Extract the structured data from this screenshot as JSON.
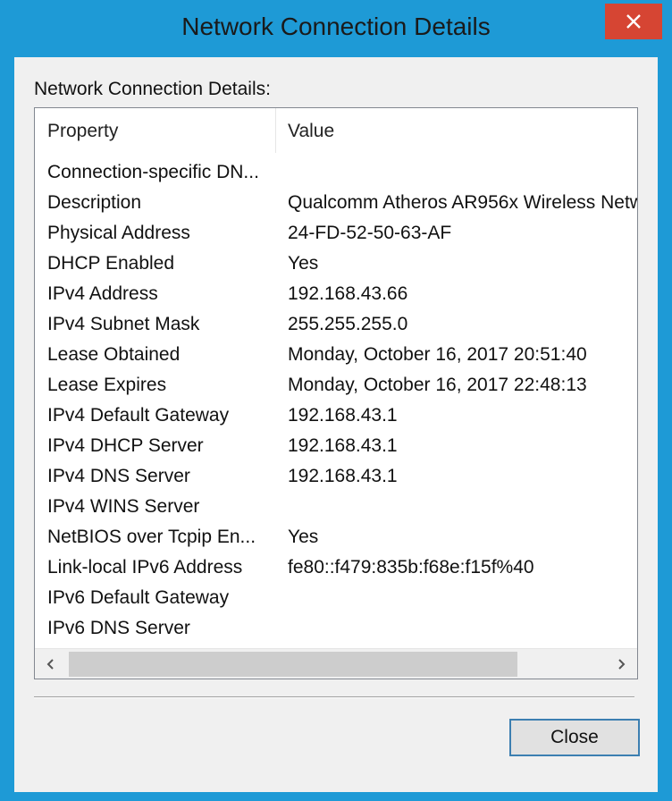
{
  "window": {
    "title": "Network Connection Details",
    "close_icon": "close-icon"
  },
  "group_label": "Network Connection Details:",
  "table": {
    "columns": [
      "Property",
      "Value"
    ],
    "rows": [
      {
        "property": "Connection-specific DN...",
        "value": ""
      },
      {
        "property": "Description",
        "value": "Qualcomm Atheros AR956x Wireless Netw"
      },
      {
        "property": "Physical Address",
        "value": "24-FD-52-50-63-AF"
      },
      {
        "property": "DHCP Enabled",
        "value": "Yes"
      },
      {
        "property": "IPv4 Address",
        "value": "192.168.43.66"
      },
      {
        "property": "IPv4 Subnet Mask",
        "value": "255.255.255.0"
      },
      {
        "property": "Lease Obtained",
        "value": "Monday, October 16, 2017 20:51:40"
      },
      {
        "property": "Lease Expires",
        "value": "Monday, October 16, 2017 22:48:13"
      },
      {
        "property": "IPv4 Default Gateway",
        "value": "192.168.43.1"
      },
      {
        "property": "IPv4 DHCP Server",
        "value": "192.168.43.1"
      },
      {
        "property": "IPv4 DNS Server",
        "value": "192.168.43.1"
      },
      {
        "property": "IPv4 WINS Server",
        "value": ""
      },
      {
        "property": "NetBIOS over Tcpip En...",
        "value": "Yes"
      },
      {
        "property": "Link-local IPv6 Address",
        "value": "fe80::f479:835b:f68e:f15f%40"
      },
      {
        "property": "IPv6 Default Gateway",
        "value": ""
      },
      {
        "property": "IPv6 DNS Server",
        "value": ""
      }
    ]
  },
  "scrollbar": {
    "left_icon": "chevron-left-icon",
    "right_icon": "chevron-right-icon"
  },
  "buttons": {
    "close_label": "Close"
  },
  "colors": {
    "frame": "#1e9ad6",
    "close_button_bg": "#d64533",
    "client_bg": "#f0f0f0"
  }
}
